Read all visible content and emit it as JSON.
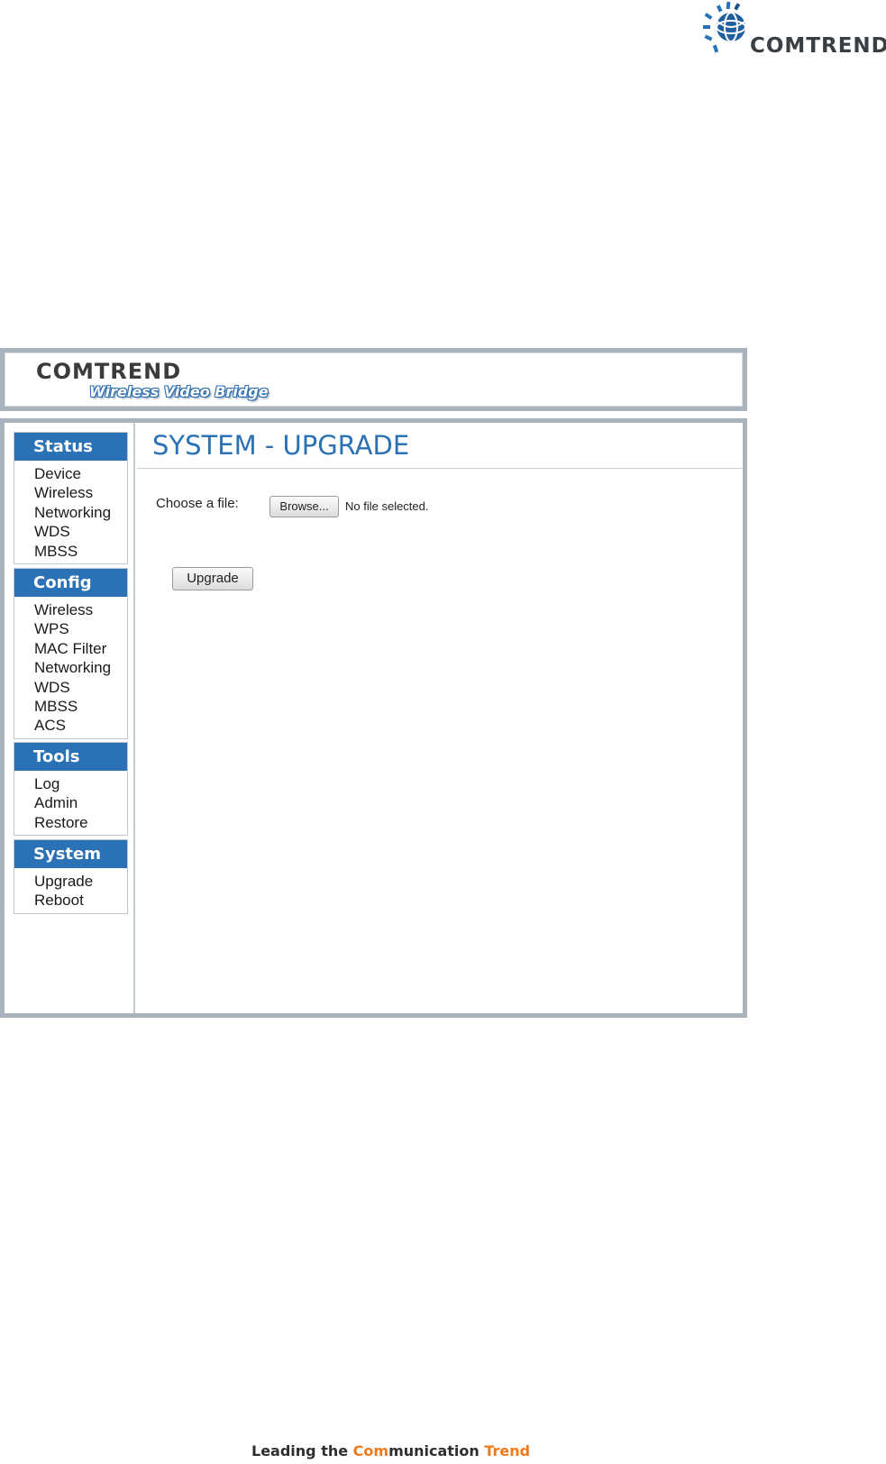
{
  "corporate_logo": {
    "text": "COMTREND",
    "accent_color": "#2a72b5"
  },
  "header": {
    "brand": "COMTREND",
    "product": "Wireless Video Bridge"
  },
  "sidebar": {
    "groups": [
      {
        "title": "Status",
        "items": [
          "Device",
          "Wireless",
          "Networking",
          "WDS",
          "MBSS"
        ]
      },
      {
        "title": "Config",
        "items": [
          "Wireless",
          "WPS",
          "MAC Filter",
          "Networking",
          "WDS",
          "MBSS",
          "ACS"
        ]
      },
      {
        "title": "Tools",
        "items": [
          "Log",
          "Admin",
          "Restore"
        ]
      },
      {
        "title": "System",
        "items": [
          "Upgrade",
          "Reboot"
        ]
      }
    ]
  },
  "main": {
    "title": "SYSTEM - UPGRADE",
    "file_label": "Choose a file:",
    "browse_label": "Browse...",
    "file_status": "No file selected.",
    "upgrade_label": "Upgrade"
  },
  "footer": {
    "tagline_parts": [
      "Leading the ",
      "Com",
      "munication ",
      "Trend"
    ],
    "accent_color": "#f07a1a"
  }
}
